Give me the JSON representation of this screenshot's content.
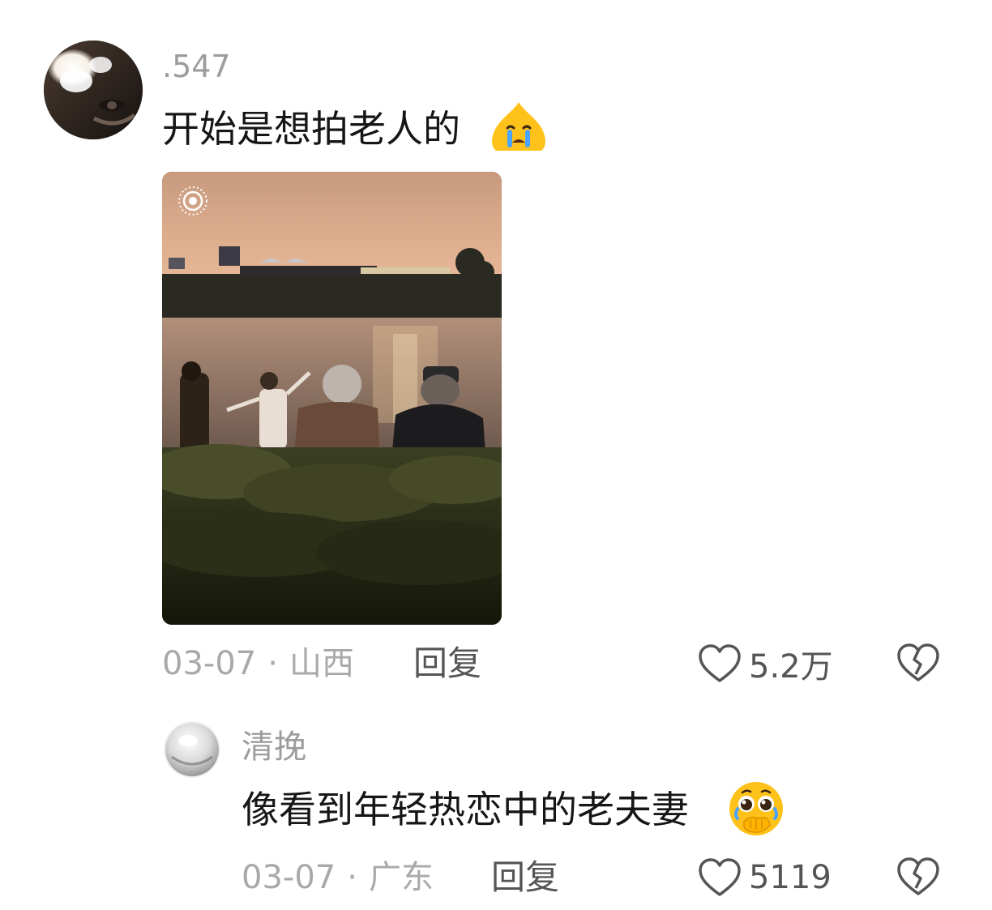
{
  "comments": [
    {
      "username": ".547",
      "text": "开始是想拍老人的",
      "emoji": "loudly-crying-face",
      "has_photo": true,
      "photo_badge": "live-photo-icon",
      "date": "03-07",
      "location": "山西",
      "separator": "·",
      "reply_label": "回复",
      "like_count": "5.2万"
    },
    {
      "username": "清挽",
      "text": "像看到年轻热恋中的老夫妻",
      "emoji": "face-holding-back-tears",
      "date": "03-07",
      "location": "广东",
      "separator": "·",
      "reply_label": "回复",
      "like_count": "5119"
    }
  ],
  "icons": {
    "like": "heart-outline-icon",
    "dislike": "broken-heart-icon"
  },
  "colors": {
    "text": "#161616",
    "secondary": "#a9a9a9",
    "username": "#9c9c9c",
    "emoji_yellow": "#ffc21a",
    "icon": "#555555"
  }
}
